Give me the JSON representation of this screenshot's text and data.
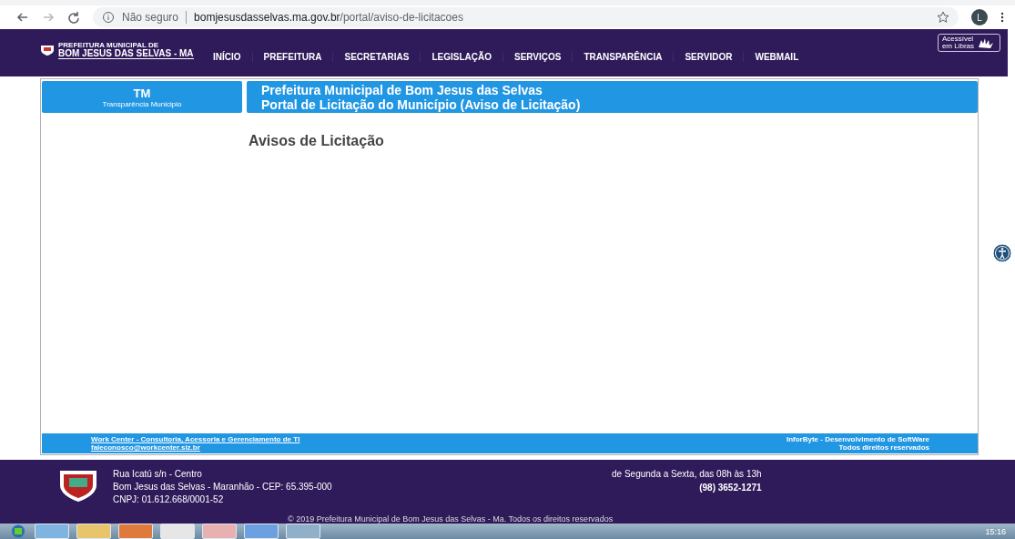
{
  "browser": {
    "security": "Não seguro",
    "url_host": "bomjesusdasselvas.ma.gov.br",
    "url_path": "/portal/aviso-de-licitacoes",
    "profile": "L"
  },
  "site": {
    "logo_small": "PREFEITURA MUNICIPAL DE",
    "logo_big": "BOM JESUS DAS SELVAS - MA",
    "nav": [
      {
        "label": "INÍCIO"
      },
      {
        "label": "PREFEITURA"
      },
      {
        "label": "SECRETARIAS"
      },
      {
        "label": "LEGISLAÇÃO"
      },
      {
        "label": "SERVIÇOS"
      },
      {
        "label": "TRANSPARÊNCIA"
      },
      {
        "label": "SERVIDOR"
      },
      {
        "label": "WEBMAIL"
      }
    ],
    "libras": [
      "Acessível",
      "em Libras"
    ]
  },
  "portal": {
    "badge_title": "TM",
    "badge_subtitle": "Transparência Municipio",
    "header_lines": [
      "Prefeitura Municipal de Bom Jesus das Selvas",
      "Portal de Licitação do Município (Aviso de Licitação)"
    ],
    "page_title": "Avisos de Licitação",
    "footer_left": [
      "Work Center - Consultoria, Acessoria e Gerenciamento de TI",
      "faleconosco@workcenter.slz.br"
    ],
    "footer_right": [
      "InforByte - Desenvolvimento de SoftWare",
      "Todos direitos reservados"
    ]
  },
  "site_footer": {
    "address": [
      "Rua Icatú s/n - Centro",
      "Bom Jesus das Selvas - Maranhão - CEP: 65.395-000",
      "CNPJ: 01.612.668/0001-52"
    ],
    "hours": "de Segunda a Sexta, das 08h às 13h",
    "phone": "(98) 3652-1271",
    "copyright": "© 2019 Prefeitura Municipal de Bom Jesus das Selvas - Ma. Todos os direitos reservados"
  },
  "taskbar": {
    "clock": "15:16"
  }
}
